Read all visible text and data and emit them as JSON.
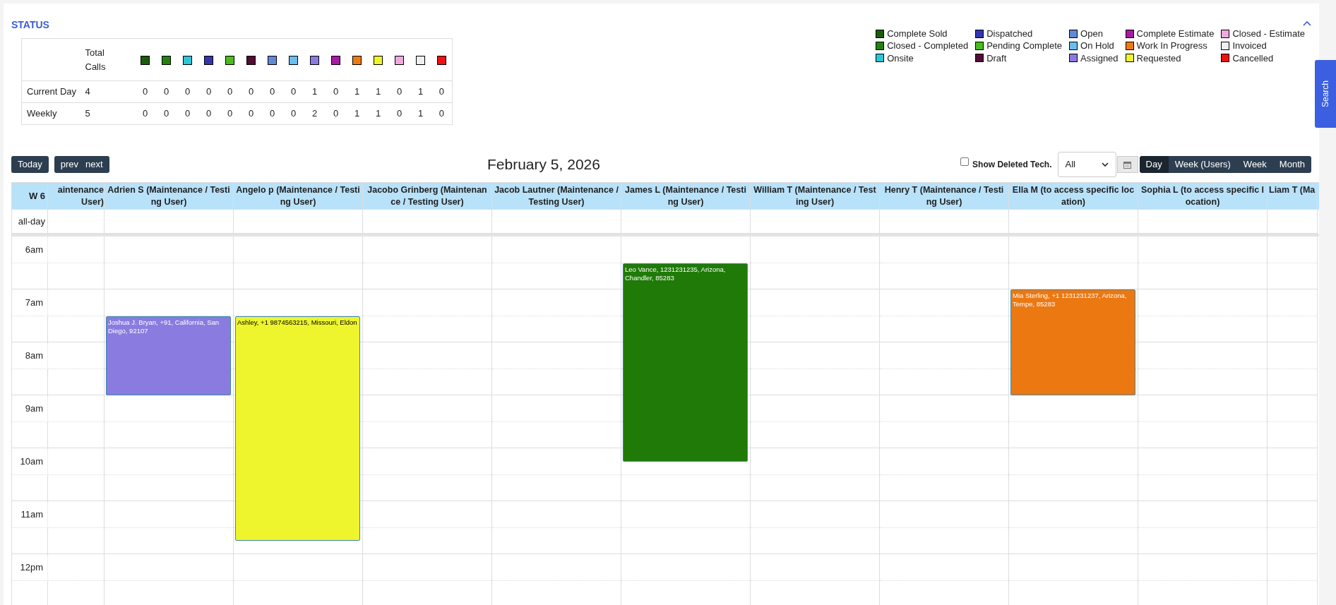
{
  "status_panel": {
    "title": "STATUS",
    "table": {
      "header_label": "Total Calls",
      "status_columns": [
        {
          "color": "#1a5c0a"
        },
        {
          "color": "#23820e"
        },
        {
          "color": "#2bc6d8"
        },
        {
          "color": "#3535b0"
        },
        {
          "color": "#4cbb1f"
        },
        {
          "color": "#520c36"
        },
        {
          "color": "#6189d4"
        },
        {
          "color": "#6bbdf0"
        },
        {
          "color": "#8a7be0"
        },
        {
          "color": "#a71aa6"
        },
        {
          "color": "#ee7a14"
        },
        {
          "color": "#eef52c"
        },
        {
          "color": "#f0a8e0"
        },
        {
          "color": "#efefef"
        },
        {
          "color": "#f01010"
        }
      ],
      "rows": [
        {
          "label": "Current Day",
          "total": "4",
          "counts": [
            "0",
            "0",
            "0",
            "0",
            "0",
            "0",
            "0",
            "0",
            "1",
            "0",
            "1",
            "1",
            "0",
            "1",
            "0"
          ]
        },
        {
          "label": "Weekly",
          "total": "5",
          "counts": [
            "0",
            "0",
            "0",
            "0",
            "0",
            "0",
            "0",
            "0",
            "2",
            "0",
            "1",
            "1",
            "0",
            "1",
            "0"
          ]
        }
      ]
    },
    "legend": [
      {
        "label": "Complete Sold",
        "color": "#1a5c0a"
      },
      {
        "label": "Closed - Completed",
        "color": "#23820e"
      },
      {
        "label": "Onsite",
        "color": "#2bc6d8"
      },
      {
        "label": "Dispatched",
        "color": "#3535b0"
      },
      {
        "label": "Pending Complete",
        "color": "#4cbb1f"
      },
      {
        "label": "Draft",
        "color": "#520c36"
      },
      {
        "label": "Open",
        "color": "#6189d4"
      },
      {
        "label": "On Hold",
        "color": "#6bbdf0"
      },
      {
        "label": "Assigned",
        "color": "#8a7be0"
      },
      {
        "label": "Complete Estimate",
        "color": "#a71aa6"
      },
      {
        "label": "Work In Progress",
        "color": "#ee7a14"
      },
      {
        "label": "Requested",
        "color": "#eef52c"
      },
      {
        "label": "Closed - Estimate",
        "color": "#f0a8e0"
      },
      {
        "label": "Invoiced",
        "color": "#efefef"
      },
      {
        "label": "Cancelled",
        "color": "#f01010"
      }
    ]
  },
  "search_tab": "Search",
  "toolbar": {
    "today": "Today",
    "prev": "prev",
    "next": "next",
    "date_title": "February 5, 2026",
    "show_deleted": {
      "label": "Show Deleted Tech.",
      "checked": false
    },
    "filter": "All",
    "views": [
      {
        "label": "Day",
        "selected": true
      },
      {
        "label": "Week (Users)",
        "selected": false
      },
      {
        "label": "Week",
        "selected": false
      },
      {
        "label": "Month",
        "selected": false
      }
    ]
  },
  "calendar": {
    "week_label": "W 6",
    "all_day_label": "all-day",
    "columns": [
      {
        "header": "aintenance User)"
      },
      {
        "header": "Adrien S (Maintenance / Testing User)",
        "events": [
          {
            "color": "#8a7be0",
            "text": "Joshua J. Bryan, +91, California, San Diego, 92107"
          }
        ]
      },
      {
        "header": "Angelo p (Maintenance / Testing User)",
        "events": [
          {
            "color": "#eef52c",
            "text": "Ashley, +1 9874563215, Missouri, Eldon"
          }
        ]
      },
      {
        "header": "Jacobo Grinberg (Maintenance / Testing User)"
      },
      {
        "header": "Jacob Lautner (Maintenance / Testing User)"
      },
      {
        "header": "James L (Maintenance / Testing User)",
        "events": [
          {
            "color": "#1f7a07",
            "text": "Leo Vance, 1231231235, Arizona, Chandler, 85283"
          }
        ]
      },
      {
        "header": "William T (Maintenance / Testing User)"
      },
      {
        "header": "Henry T (Maintenance / Testing User)"
      },
      {
        "header": "Ella M (to access specific location)",
        "events": [
          {
            "color": "#eb7811",
            "text": "Mia Sterling, +1 1231231237, Arizona, Tempe, 85283"
          }
        ]
      },
      {
        "header": "Sophia L (to access specific location)"
      },
      {
        "header": "Liam T (Ma"
      }
    ],
    "times": [
      "6am",
      "7am",
      "8am",
      "9am",
      "10am",
      "11am",
      "12pm"
    ]
  }
}
